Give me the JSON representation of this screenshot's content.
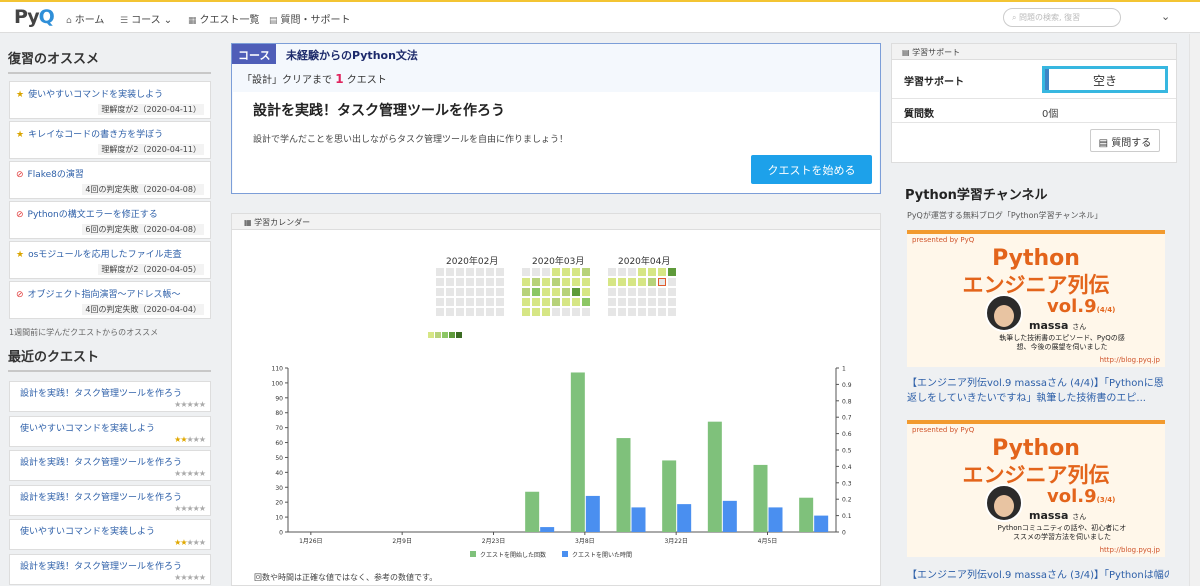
{
  "nav": {
    "logo": "PyQ",
    "home": "ホーム",
    "course": "コース",
    "quests": "クエスト一覧",
    "support": "質問・サポート",
    "search_placeholder": "問題の検索, 復習"
  },
  "review": {
    "title": "復習のオススメ",
    "items": [
      {
        "icon": "star",
        "title": "使いやすいコマンドを実装しよう",
        "meta": "理解度が2（2020-04-11）"
      },
      {
        "icon": "star",
        "title": "キレイなコードの書き方を学ぼう",
        "meta": "理解度が2（2020-04-11）"
      },
      {
        "icon": "ban",
        "title": "Flake8の演習",
        "meta": "4回の判定失敗（2020-04-08）"
      },
      {
        "icon": "ban",
        "title": "Pythonの構文エラーを修正する",
        "meta": "6回の判定失敗（2020-04-08）"
      },
      {
        "icon": "star",
        "title": "osモジュールを応用したファイル走査",
        "meta": "理解度が2（2020-04-05）"
      },
      {
        "icon": "ban",
        "title": "オブジェクト指向演習〜アドレス帳〜",
        "meta": "4回の判定失敗（2020-04-04）"
      }
    ],
    "note": "1週間前に学んだクエストからのオススメ"
  },
  "recent": {
    "title": "最近のクエスト",
    "items": [
      {
        "title": "設計を実践！タスク管理ツールを作ろう",
        "stars": 0
      },
      {
        "title": "使いやすいコマンドを実装しよう",
        "stars": 2
      },
      {
        "title": "設計を実践！タスク管理ツールを作ろう",
        "stars": 0
      },
      {
        "title": "設計を実践！タスク管理ツールを作ろう",
        "stars": 0
      },
      {
        "title": "使いやすいコマンドを実装しよう",
        "stars": 2
      },
      {
        "title": "設計を実践！タスク管理ツールを作ろう",
        "stars": 0
      }
    ]
  },
  "course": {
    "badge": "コース",
    "name": "未経験からのPython文法",
    "clear_prefix": "「設計」クリアまで ",
    "clear_count": "1",
    "clear_suffix": " クエスト",
    "quest_title": "設計を実践！タスク管理ツールを作ろう",
    "quest_desc": "設計で学んだことを思い出しながらタスク管理ツールを自由に作りましょう！",
    "start_label": "クエストを始める"
  },
  "calendar": {
    "header": "学習カレンダー",
    "months": [
      "2020年02月",
      "2020年03月",
      "2020年04月"
    ],
    "legend_colors": [
      "#d6e685",
      "#b7d27a",
      "#8cc665",
      "#5e9a3a",
      "#3b6b22"
    ],
    "month_cells": [
      [
        0,
        0,
        0,
        0,
        0,
        0,
        0,
        0,
        0,
        0,
        0,
        0,
        0,
        0,
        0,
        0,
        0,
        0,
        0,
        0,
        0,
        0,
        0,
        0,
        0,
        0,
        0,
        0,
        0,
        0,
        0,
        0,
        0,
        0,
        0
      ],
      [
        0,
        0,
        0,
        1,
        1,
        1,
        2,
        1,
        2,
        1,
        2,
        1,
        1,
        1,
        2,
        3,
        1,
        1,
        2,
        4,
        1,
        1,
        1,
        1,
        2,
        1,
        1,
        3,
        1,
        1,
        1,
        0,
        0,
        0,
        0
      ],
      [
        0,
        0,
        0,
        1,
        1,
        1,
        4,
        1,
        1,
        1,
        1,
        2,
        9,
        0,
        0,
        0,
        0,
        0,
        0,
        0,
        0,
        0,
        0,
        0,
        0,
        0,
        0,
        0,
        0,
        0,
        0,
        0,
        0,
        0,
        0
      ]
    ],
    "note": "回数や時間は正確な値ではなく、参考の数値です。"
  },
  "chart_data": {
    "type": "bar",
    "categories": [
      "1月26日",
      "2月2日",
      "2月9日",
      "2月16日",
      "2月23日",
      "3月1日",
      "3月8日",
      "3月15日",
      "3月22日",
      "3月29日",
      "4月5日",
      "4月12日"
    ],
    "x_tick_labels": [
      "1月26日",
      "2月9日",
      "2月23日",
      "3月8日",
      "3月22日",
      "4月5日"
    ],
    "series": [
      {
        "name": "クエストを開始した回数",
        "axis": "left",
        "color": "#7fc17b",
        "values": [
          0,
          0,
          0,
          0,
          0,
          27,
          107,
          63,
          48,
          74,
          45,
          23
        ]
      },
      {
        "name": "クエストを開いた時間",
        "axis": "right",
        "color": "#4a8ff0",
        "values": [
          0,
          0,
          0,
          0,
          0,
          0.03,
          0.22,
          0.15,
          0.17,
          0.19,
          0.15,
          0.1
        ]
      }
    ],
    "ylim_left": [
      0,
      110
    ],
    "yticks_left": [
      0,
      10,
      20,
      30,
      40,
      50,
      60,
      70,
      80,
      90,
      100,
      110
    ],
    "ylim_right": [
      0,
      1
    ],
    "yticks_right": [
      0,
      0.1,
      0.2,
      0.3,
      0.4,
      0.5,
      0.6,
      0.7,
      0.8,
      0.9,
      1
    ],
    "legend": "bottom"
  },
  "support": {
    "header": "学習サポート",
    "label": "学習サポート",
    "status": "空き",
    "count_label": "質問数",
    "count": "0個",
    "ask_label": "質問する"
  },
  "channel": {
    "title": "Python学習チャンネル",
    "subtitle": "PyQが運営する無料ブログ「Python学習チャンネル」",
    "banners": [
      {
        "pre": "presented by PyQ",
        "py": "Python",
        "ej": "エンジニア列伝",
        "vol": "vol.9",
        "part": "(4/4)",
        "name": "massa",
        "san": "さん",
        "desc": "執筆した技術書のエピソード、PyQの感想、今後の展望を伺いました",
        "url": "http://blog.pyq.jp",
        "link": "【エンジニア列伝vol.9 massaさん (4/4)】「Pythonに恩返しをしていきたいですね」執筆した技術書のエピ..."
      },
      {
        "pre": "presented by PyQ",
        "py": "Python",
        "ej": "エンジニア列伝",
        "vol": "vol.9",
        "part": "(3/4)",
        "name": "massa",
        "san": "さん",
        "desc": "Pythonコミュニティの話や、初心者にオススメの学習方法を伺いました",
        "url": "http://blog.pyq.jp",
        "link": "【エンジニア列伝vol.9 massaさん (3/4)】「Pythonは幅の広い"
      }
    ]
  }
}
